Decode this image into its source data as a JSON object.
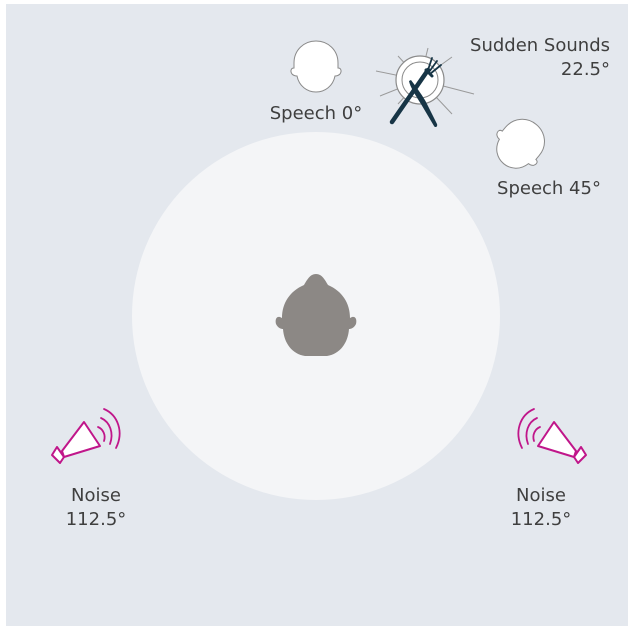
{
  "sources": {
    "speech_front": {
      "label": "Speech 0°",
      "icon": "head-outline-icon"
    },
    "sudden_sounds": {
      "label_line1": "Sudden Sounds",
      "label_line2": "22.5°",
      "icon": "plate-cutlery-icon"
    },
    "speech_45": {
      "label": "Speech 45°",
      "icon": "head-outline-icon"
    },
    "noise_left": {
      "label_line1": "Noise",
      "label_line2": "112.5°",
      "icon": "speaker-icon"
    },
    "noise_right": {
      "label_line1": "Noise",
      "label_line2": "112.5°",
      "icon": "speaker-icon"
    }
  },
  "listener": {
    "icon": "listener-head-icon"
  },
  "colors": {
    "background": "#e4e8ee",
    "circle": "#f4f5f7",
    "listener": "#8c8885",
    "speaker": "#c0168a",
    "cutlery": "#173546",
    "text": "#3f3f3f"
  }
}
